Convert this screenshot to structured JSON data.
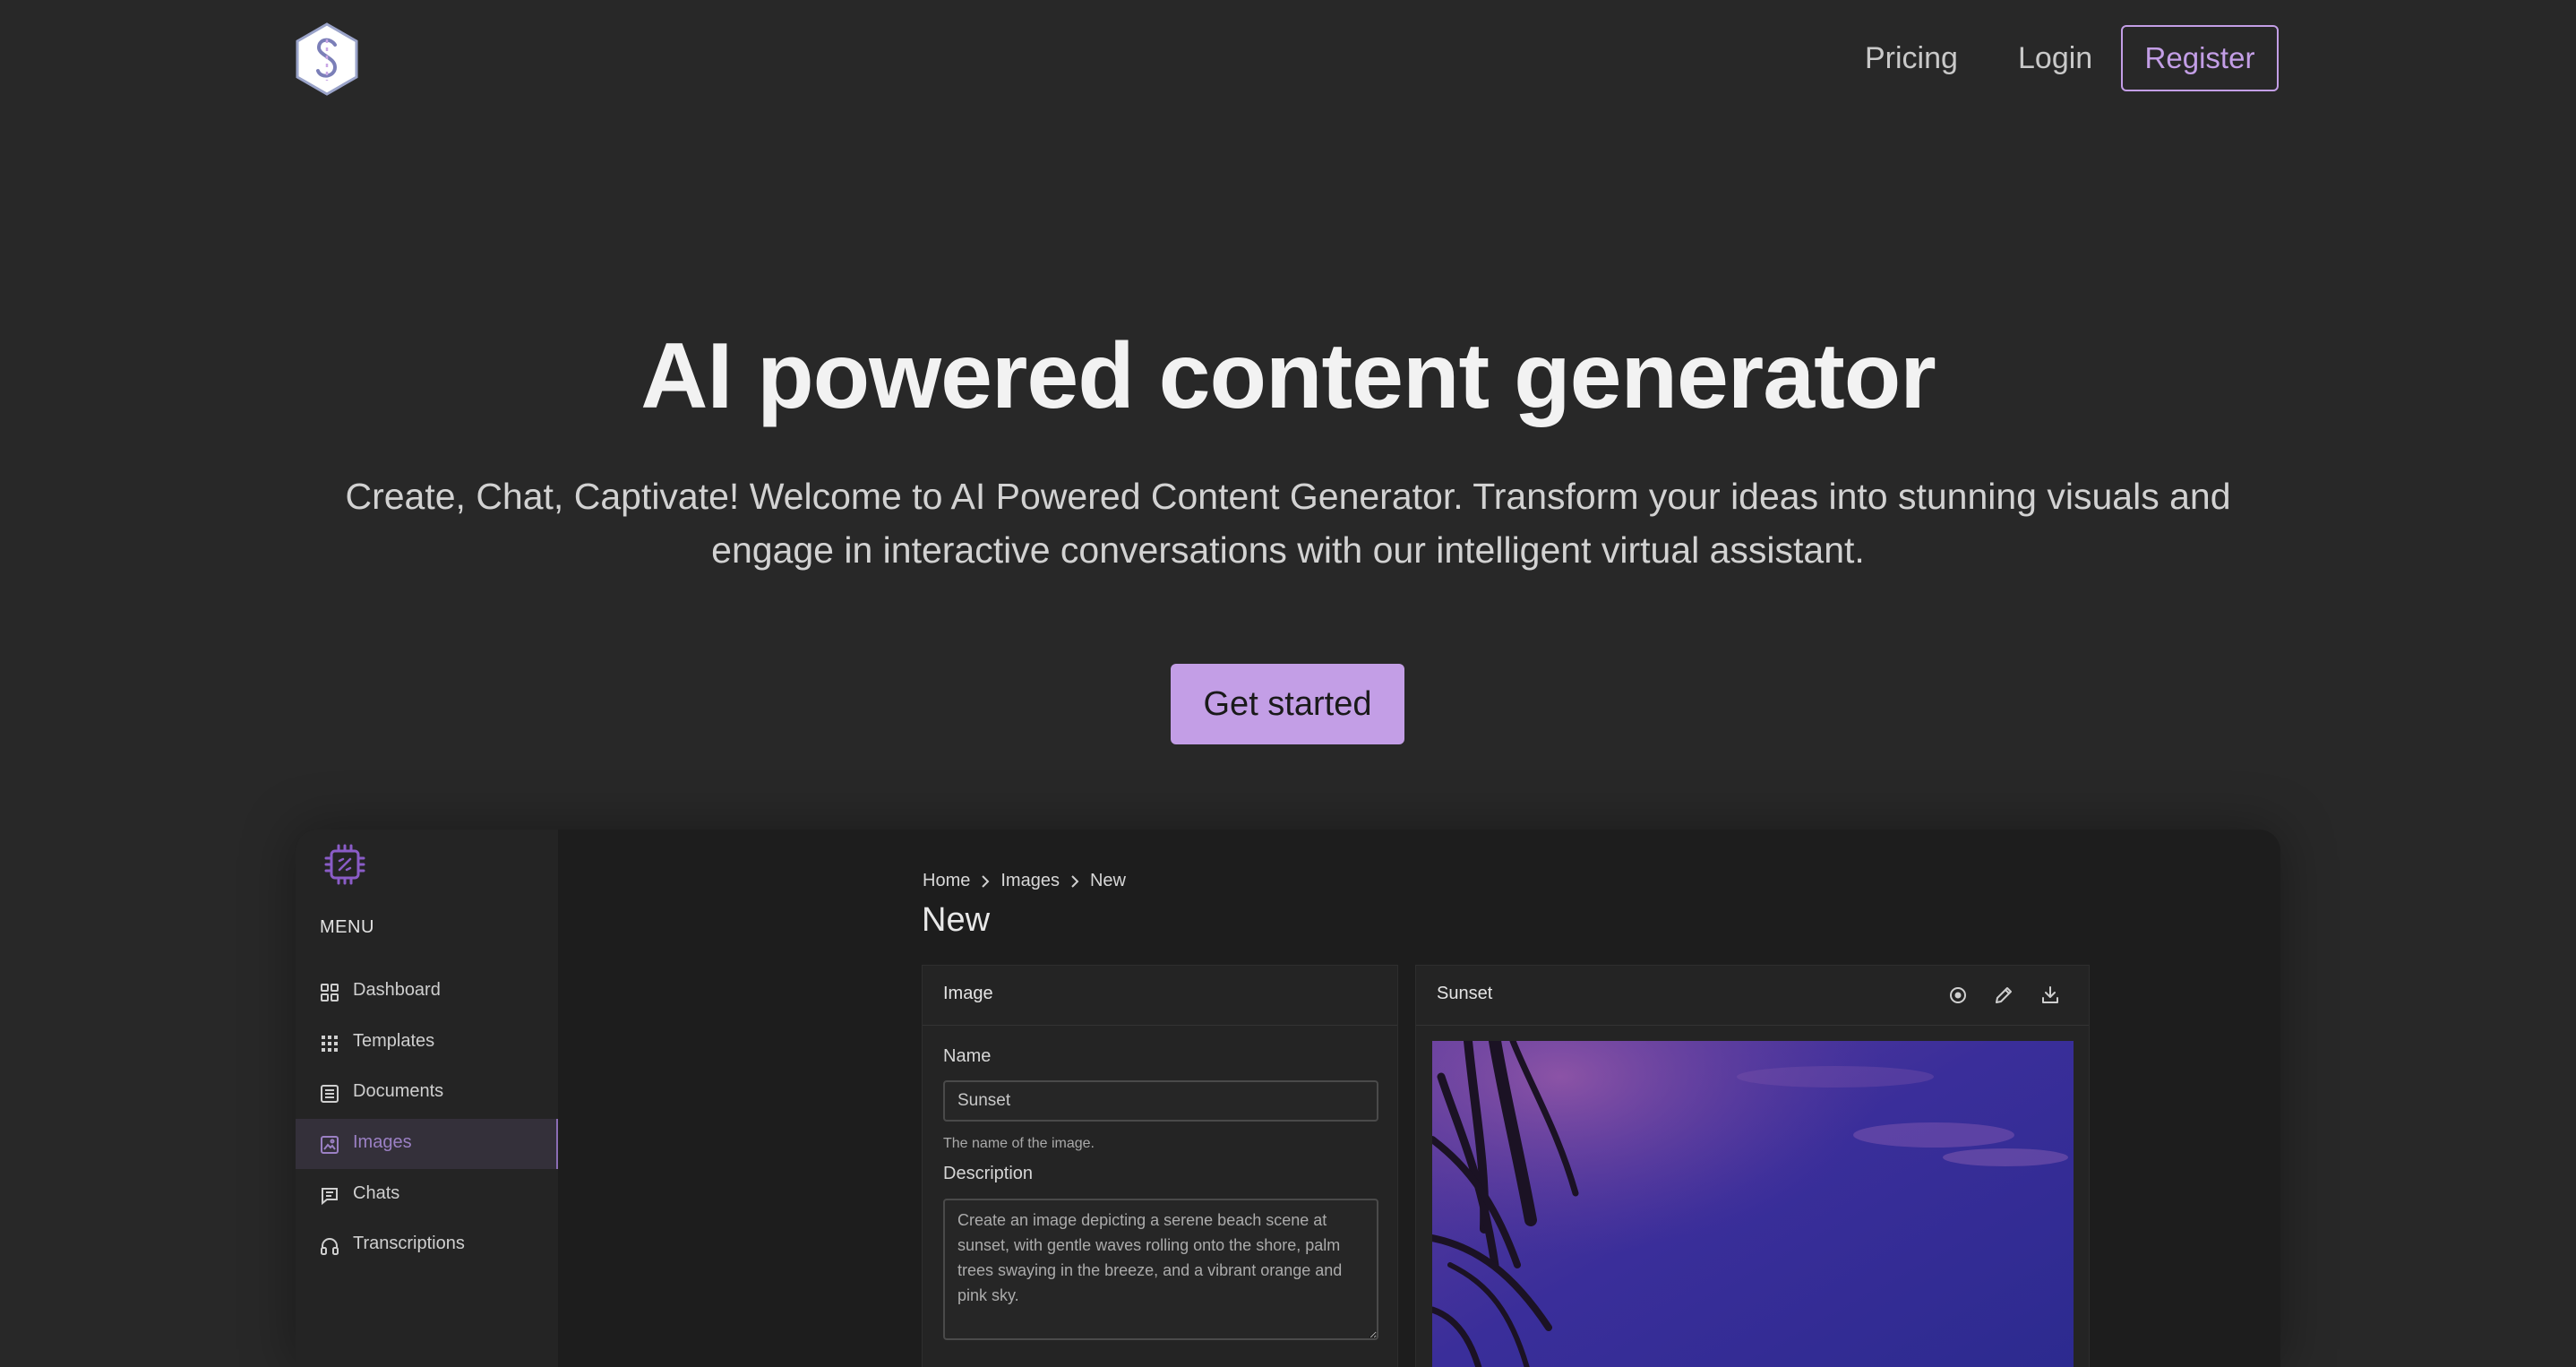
{
  "nav": {
    "pricing": "Pricing",
    "login": "Login",
    "register": "Register"
  },
  "hero": {
    "title": "AI powered content generator",
    "subtitle_line1": "Create, Chat, Captivate! Welcome to AI Powered Content Generator. Transform your ideas into stunning visuals and",
    "subtitle_line2": "engage in interactive conversations with our intelligent virtual assistant.",
    "cta": "Get started"
  },
  "app": {
    "menu_heading": "MENU",
    "sidebar": {
      "items": [
        {
          "label": "Dashboard",
          "icon": "dashboard-icon"
        },
        {
          "label": "Templates",
          "icon": "templates-icon"
        },
        {
          "label": "Documents",
          "icon": "documents-icon"
        },
        {
          "label": "Images",
          "icon": "images-icon",
          "active": true
        },
        {
          "label": "Chats",
          "icon": "chats-icon"
        },
        {
          "label": "Transcriptions",
          "icon": "headphones-icon"
        }
      ]
    },
    "breadcrumb": [
      "Home",
      "Images",
      "New"
    ],
    "page_title": "New",
    "image_form": {
      "title": "Image",
      "name_label": "Name",
      "name_value": "Sunset",
      "name_help": "The name of the image.",
      "description_label": "Description",
      "description_value": "Create an image depicting a serene beach scene at sunset, with gentle waves rolling onto the shore, palm trees swaying in the breeze, and a vibrant orange and pink sky."
    },
    "result": {
      "title": "Sunset",
      "icons": [
        "view-icon",
        "edit-icon",
        "download-icon"
      ]
    }
  },
  "colors": {
    "background": "#282828",
    "accent": "#c39ee6",
    "sidebar": "#242424"
  }
}
